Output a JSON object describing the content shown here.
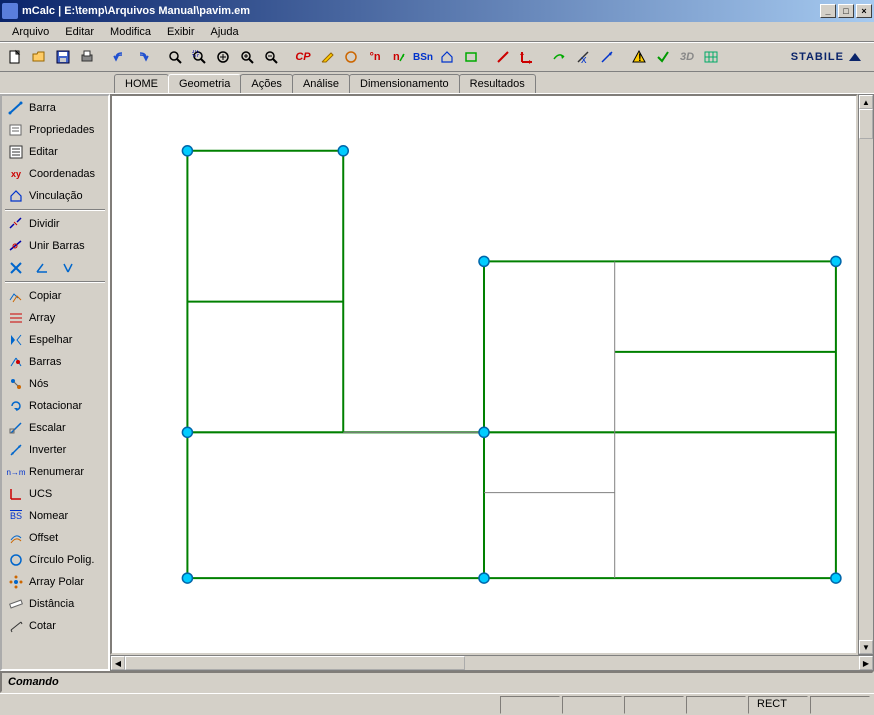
{
  "title": "mCalc | E:\\temp\\Arquivos Manual\\pavim.em",
  "menu": [
    "Arquivo",
    "Editar",
    "Modifica",
    "Exibir",
    "Ajuda"
  ],
  "tabs": [
    "HOME",
    "Geometria",
    "Ações",
    "Análise",
    "Dimensionamento",
    "Resultados"
  ],
  "active_tab": 1,
  "brand": "STABILE",
  "sidebar": {
    "group1": [
      "Barra",
      "Propriedades",
      "Editar",
      "Coordenadas",
      "Vinculação"
    ],
    "group2": [
      "Dividir",
      "Unir Barras"
    ],
    "group3": [
      "Copiar",
      "Array",
      "Espelhar",
      "Barras",
      "Nós",
      "Rotacionar",
      "Escalar",
      "Inverter",
      "Renumerar",
      "UCS",
      "Nomear",
      "Offset",
      "Círculo Polig.",
      "Array Polar",
      "Distância",
      "Cotar"
    ]
  },
  "command_label": "Comando",
  "status": {
    "rect": "RECT"
  },
  "toolbar_icons": {
    "new": "new-file-icon",
    "open": "open-folder-icon",
    "save": "save-icon",
    "print": "print-icon",
    "undo": "undo-icon",
    "redo": "redo-icon",
    "zoom-window": "zoom-window-icon",
    "zoom-extents": "zoom-extents-icon",
    "zoom-all": "zoom-all-icon",
    "zoom-in": "zoom-in-icon",
    "zoom-out": "zoom-out-icon",
    "cp": "CP",
    "pencil": "pencil-icon",
    "circle": "circle-icon",
    "deg-n": "°n",
    "n-arrow": "n-arrow-icon",
    "bsn": "BSn",
    "house": "house-icon",
    "rect": "rect-icon",
    "line-red": "line-red-icon",
    "axis": "axis-red-icon",
    "arrow-green": "arrow-green-icon",
    "measure": "measure-icon",
    "arrow-blue": "arrow-blue-icon",
    "warn": "warning-icon",
    "check": "check-icon",
    "3d": "3d-icon",
    "grid": "grid-icon"
  },
  "sidebar_icons": {
    "Barra": "line-segment-icon",
    "Propriedades": "properties-icon",
    "Editar": "edit-list-icon",
    "Coordenadas": "xy-icon",
    "Vinculação": "house-icon",
    "Dividir": "divide-icon",
    "Unir Barras": "join-icon",
    "Copiar": "copy-path-icon",
    "Array": "array-icon",
    "Espelhar": "mirror-icon",
    "Barras": "bars-icon",
    "Nós": "nodes-icon",
    "Rotacionar": "rotate-icon",
    "Escalar": "scale-icon",
    "Inverter": "invert-icon",
    "Renumerar": "renumber-icon",
    "UCS": "ucs-axis-icon",
    "Nomear": "label-icon",
    "Offset": "offset-icon",
    "Círculo Polig.": "circle-polygon-icon",
    "Array Polar": "polar-array-icon",
    "Distância": "ruler-icon",
    "Cotar": "dimension-icon"
  }
}
